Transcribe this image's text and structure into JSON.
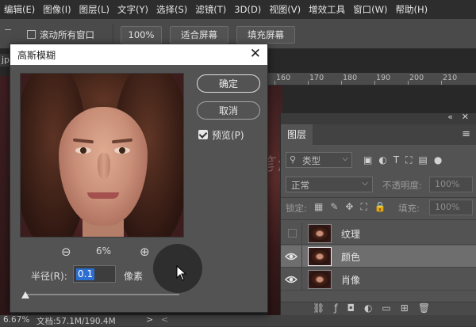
{
  "menu": [
    "编辑(E)",
    "图像(I)",
    "图层(L)",
    "文字(Y)",
    "选择(S)",
    "滤镜(T)",
    "3D(D)",
    "视图(V)",
    "增效工具",
    "窗口(W)",
    "帮助(H)"
  ],
  "options": {
    "scroll_all_label": "滚动所有窗口",
    "zoom_value": "100%",
    "fit_screen": "适合屏幕",
    "fill_screen": "填充屏幕"
  },
  "document": {
    "tab_fragment": "jpg",
    "ruler_labels": [
      "160",
      "170",
      "180",
      "190",
      "200",
      "210"
    ]
  },
  "status": {
    "zoom": "6.67%",
    "doc_info": "文档:57.1M/190.4M",
    "arrow": ">",
    "scroll_arrow": "<"
  },
  "dialog": {
    "title": "高斯模糊",
    "ok": "确定",
    "cancel": "取消",
    "preview_label": "预览(P)",
    "preview_checked": true,
    "zoom_percent": "6%",
    "radius_label": "半径(R):",
    "radius_value": "0.1",
    "radius_unit": "像素"
  },
  "watermark": "油菜的PS笔记",
  "layers_panel": {
    "title": "图层",
    "filter_kind": "类型",
    "blend_mode": "正常",
    "opacity_label": "不透明度:",
    "opacity_value": "100%",
    "lock_label": "锁定:",
    "fill_label": "填充:",
    "fill_value": "100%",
    "layers": [
      {
        "name": "纹理",
        "visible": false,
        "selected": false
      },
      {
        "name": "颜色",
        "visible": true,
        "selected": true
      },
      {
        "name": "肖像",
        "visible": true,
        "selected": false
      }
    ]
  },
  "colors": {
    "panel_bg": "#535353",
    "menubar_bg": "#2d2d2d",
    "selection_blue": "#2c6ed1"
  }
}
